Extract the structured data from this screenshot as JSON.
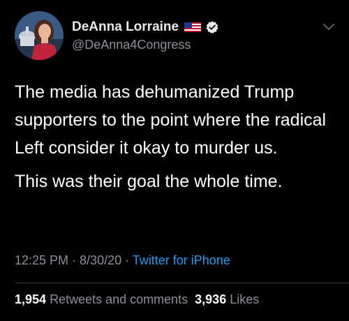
{
  "user": {
    "display_name": "DeAnna Lorraine",
    "handle": "@DeAnna4Congress"
  },
  "icons": {
    "flag": "us-flag-icon",
    "verified": "verified-badge-icon",
    "more": "chevron-down-icon"
  },
  "tweet": {
    "paragraphs": [
      "The media has dehumanized Trump supporters to the point where the radical Left consider it okay to murder us.",
      "This was their goal the whole time."
    ]
  },
  "meta": {
    "time": "12:25 PM",
    "sep1": " · ",
    "date": "8/30/20",
    "sep2": " · ",
    "source": "Twitter for iPhone"
  },
  "stats": {
    "retweets_count": "1,954",
    "retweets_label": "Retweets and comments",
    "likes_count": "3,936",
    "likes_label": "Likes"
  },
  "colors": {
    "background": "#000000",
    "text": "#ffffff",
    "secondary": "#8b8f95",
    "link": "#1d9bf0"
  }
}
